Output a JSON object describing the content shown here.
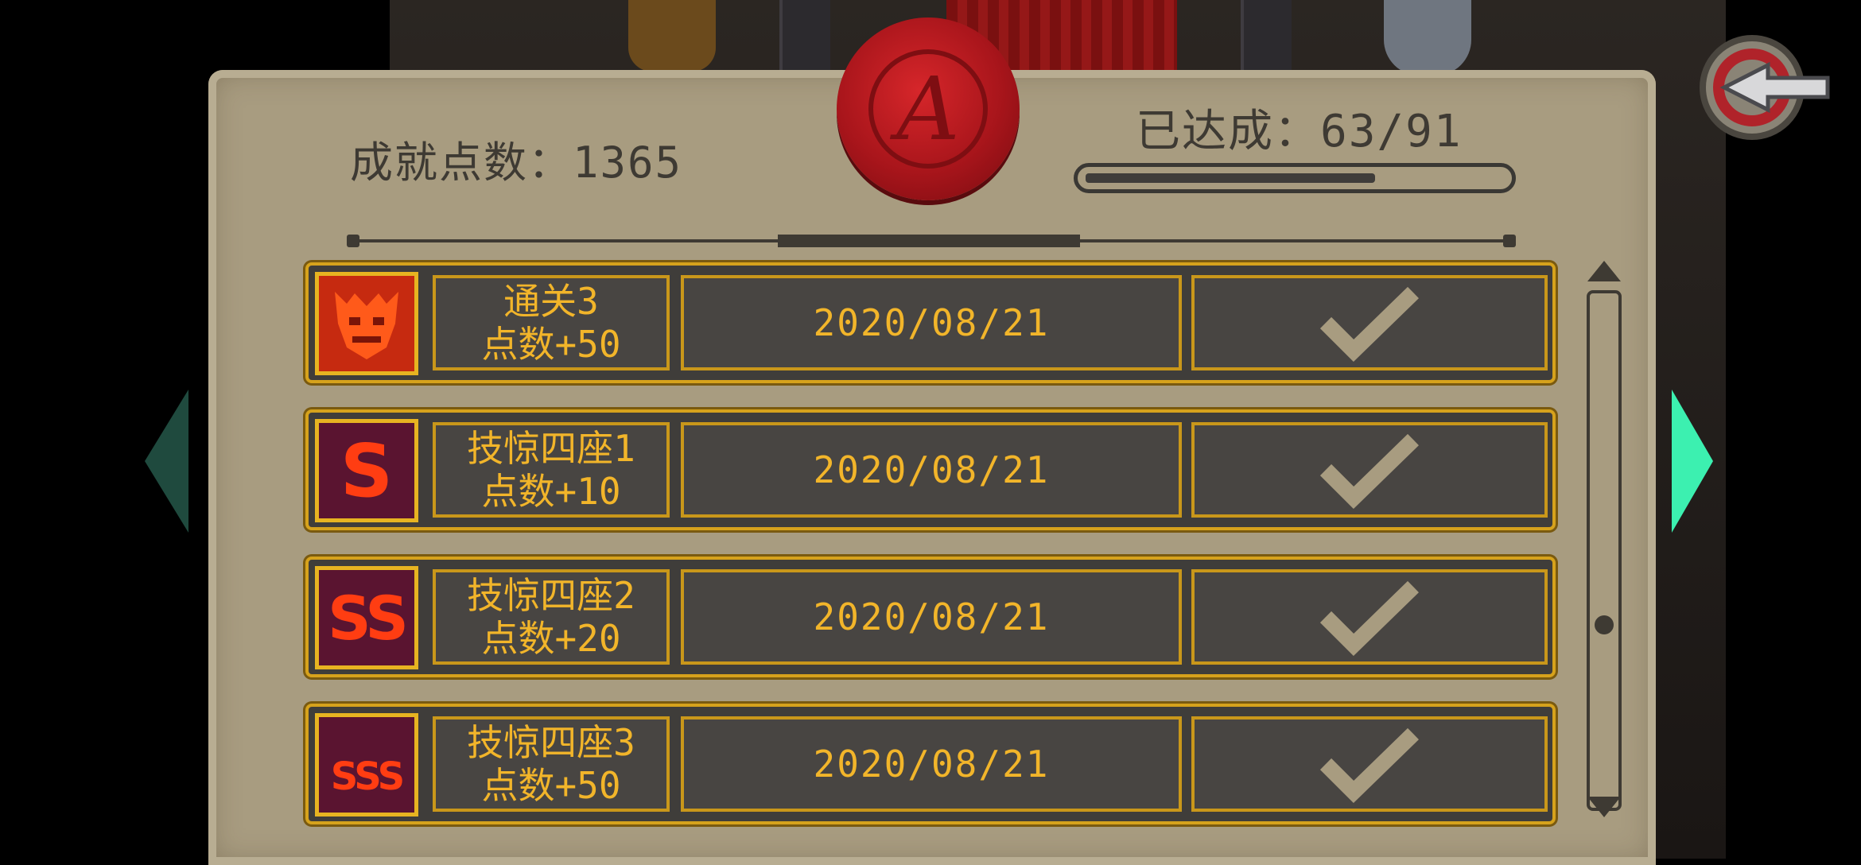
{
  "header": {
    "points_label": "成就点数：1365",
    "achieved_label": "已达成：63/91",
    "progress_fraction": 0.692
  },
  "seal": {
    "letter": "A"
  },
  "achievements": [
    {
      "name": "通关3",
      "reward": "点数+50",
      "date": "2020/08/21",
      "icon": "boss-face-icon",
      "completed": true
    },
    {
      "name": "技惊四座1",
      "reward": "点数+10",
      "date": "2020/08/21",
      "icon": "S",
      "completed": true
    },
    {
      "name": "技惊四座2",
      "reward": "点数+20",
      "date": "2020/08/21",
      "icon": "SS",
      "completed": true
    },
    {
      "name": "技惊四座3",
      "reward": "点数+50",
      "date": "2020/08/21",
      "icon": "SSS",
      "completed": true
    }
  ],
  "colors": {
    "parchment": "#a89c80",
    "row_border": "#d6a21c",
    "text_gold": "#f2b52a",
    "check": "#a89c80",
    "seal_red": "#c41e24",
    "nav_right": "#3cf0b0"
  }
}
